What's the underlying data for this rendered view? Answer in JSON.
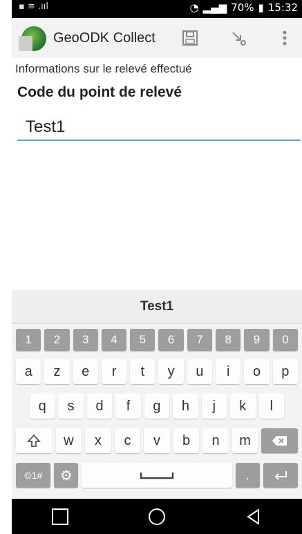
{
  "status": {
    "left": "▪ ≡ .ııl",
    "right_text": "70%",
    "time": "15:32"
  },
  "app": {
    "title": "GeoODK Collect"
  },
  "form": {
    "group_title": "Informations sur le relevé effectué",
    "question": "Code du point de relevé",
    "answer": "Test1"
  },
  "keyboard": {
    "suggestion": "Test1",
    "numbers": [
      "1",
      "2",
      "3",
      "4",
      "5",
      "6",
      "7",
      "8",
      "9",
      "0"
    ],
    "row1": [
      "a",
      "z",
      "e",
      "r",
      "t",
      "y",
      "u",
      "i",
      "o",
      "p"
    ],
    "row2": [
      "q",
      "s",
      "d",
      "f",
      "g",
      "h",
      "j",
      "k",
      "l"
    ],
    "row3": [
      "w",
      "x",
      "c",
      "v",
      "b",
      "n",
      "m"
    ],
    "symbols_label": "©1#"
  }
}
